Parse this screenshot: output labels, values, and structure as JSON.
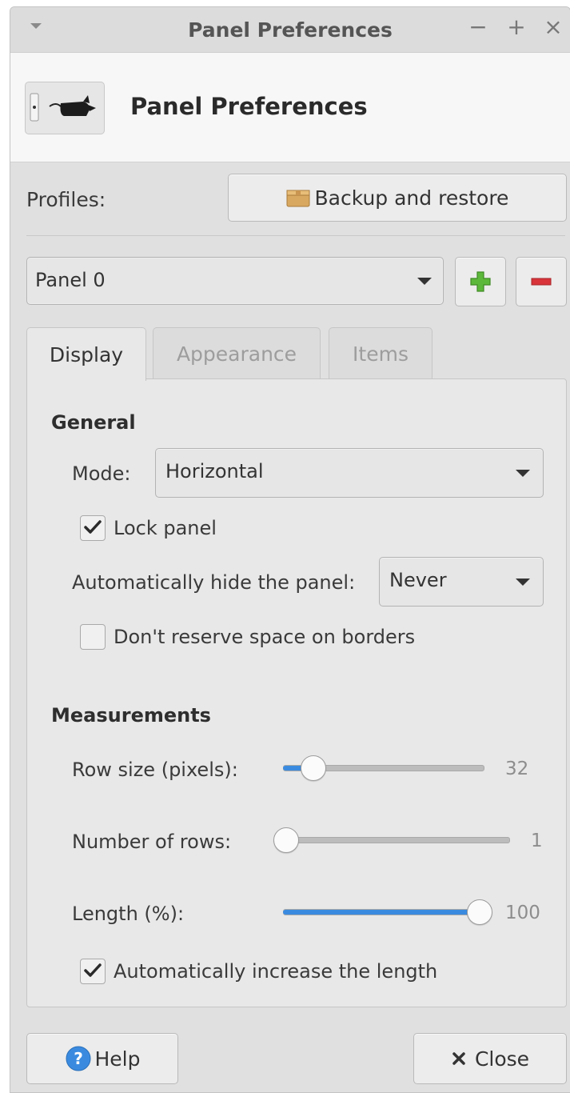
{
  "window": {
    "title": "Panel Preferences",
    "controls": {
      "minimize": "−",
      "maximize": "+",
      "close": "×"
    }
  },
  "header": {
    "title": "Panel Preferences",
    "icon": "xfce-mouse-icon"
  },
  "profiles": {
    "label": "Profiles:",
    "backup_button": "Backup and restore",
    "backup_icon": "package-box-icon"
  },
  "panel_selector": {
    "value": "Panel 0",
    "add_icon": "plus-icon",
    "remove_icon": "minus-icon"
  },
  "tabs": [
    {
      "label": "Display",
      "active": true
    },
    {
      "label": "Appearance",
      "active": false
    },
    {
      "label": "Items",
      "active": false
    }
  ],
  "general": {
    "title": "General",
    "mode_label": "Mode:",
    "mode_value": "Horizontal",
    "lock_panel_label": "Lock panel",
    "lock_panel_checked": true,
    "autohide_label": "Automatically hide the panel:",
    "autohide_value": "Never",
    "dont_reserve_label": "Don't reserve space on borders",
    "dont_reserve_checked": false
  },
  "measurements": {
    "title": "Measurements",
    "row_size_label": "Row size (pixels):",
    "row_size_value": "32",
    "rows_label": "Number of rows:",
    "rows_value": "1",
    "length_label": "Length (%):",
    "length_value": "100",
    "auto_length_label": "Automatically increase the length",
    "auto_length_checked": true
  },
  "footer": {
    "help_label": "Help",
    "close_label": "Close",
    "help_icon": "help-question-icon",
    "close_icon": "x-icon"
  },
  "colors": {
    "accent": "#3a8be0",
    "add_green": "#5cb83a",
    "remove_red": "#d8343a"
  }
}
